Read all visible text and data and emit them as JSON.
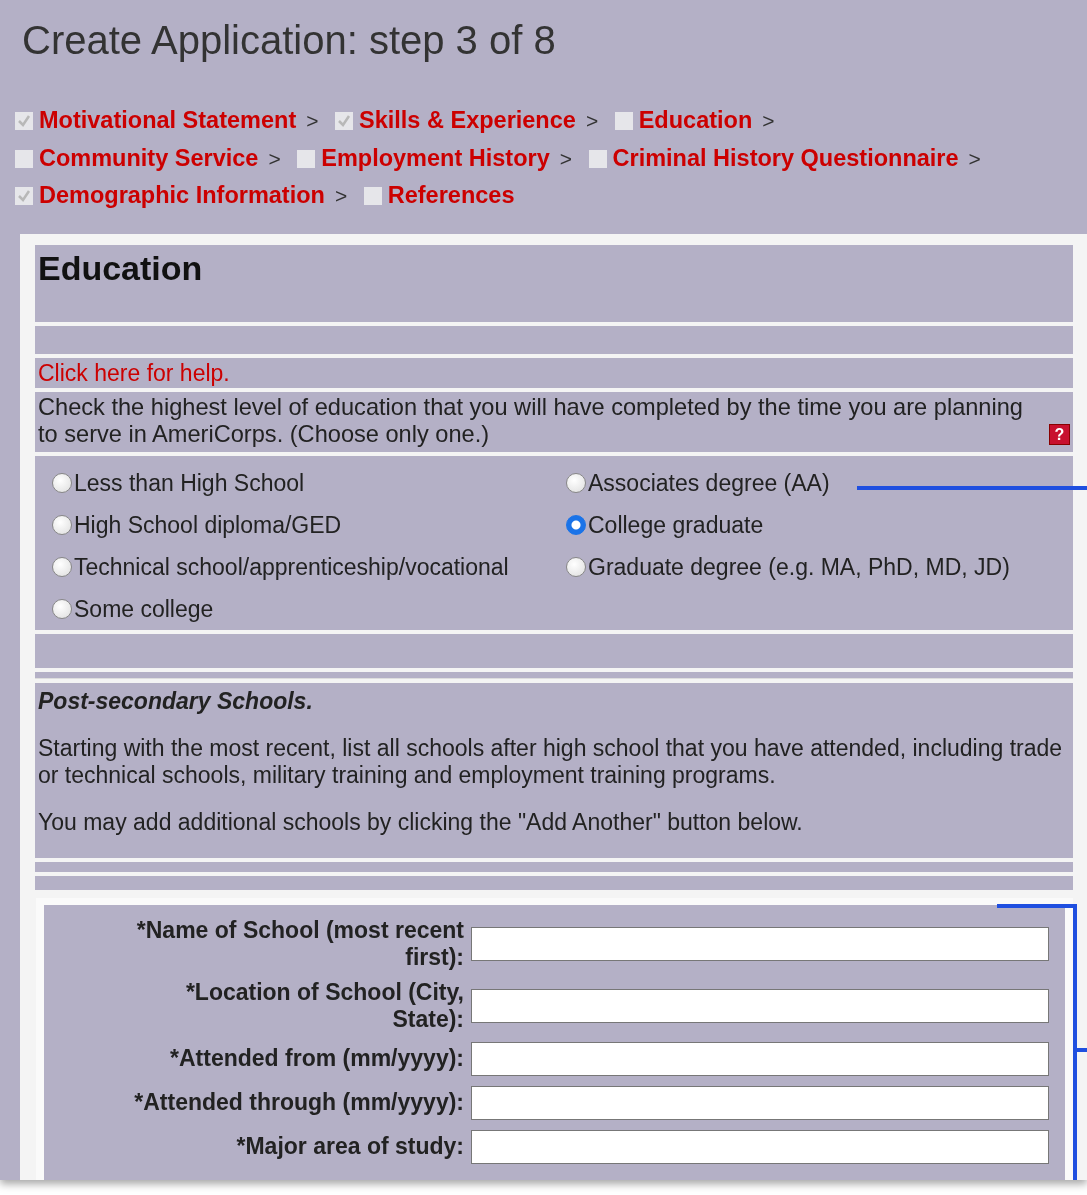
{
  "page": {
    "title": "Create Application: step 3 of 8"
  },
  "steps": [
    {
      "label": "Motivational Statement",
      "checked": true,
      "separator": ">"
    },
    {
      "label": "Skills & Experience",
      "checked": true,
      "separator": ">"
    },
    {
      "label": "Education",
      "checked": false,
      "separator": ">"
    },
    {
      "label": "Community Service",
      "checked": false,
      "separator": ">"
    },
    {
      "label": "Employment History",
      "checked": false,
      "separator": ">"
    },
    {
      "label": "Criminal History Questionnaire",
      "checked": false,
      "separator": ">"
    },
    {
      "label": "Demographic Information",
      "checked": true,
      "separator": ">"
    },
    {
      "label": "References",
      "checked": false
    }
  ],
  "education": {
    "title": "Education",
    "help_link": "Click here for help.",
    "question": "Check the highest level of education that you will have completed by the time you are planning to serve in AmeriCorps. (Choose only one.)",
    "help_icon": "?",
    "options": [
      {
        "label": "Less than High School",
        "selected": false
      },
      {
        "label": "Associates degree (AA)",
        "selected": false
      },
      {
        "label": "High School diploma/GED",
        "selected": false
      },
      {
        "label": "College graduate",
        "selected": true
      },
      {
        "label": "Technical school/apprenticeship/vocational",
        "selected": false
      },
      {
        "label": "Graduate degree (e.g. MA, PhD, MD, JD)",
        "selected": false
      },
      {
        "label": "Some college",
        "selected": false
      }
    ]
  },
  "post_secondary": {
    "title": "Post-secondary Schools.",
    "paragraphs": [
      "Starting with the most recent, list all schools after high school that you have attended, including trade or technical schools, military training and employment training programs.",
      "You may add additional schools by clicking the \"Add Another\" button below."
    ]
  },
  "school_form": {
    "fields": [
      {
        "label": "*Name of School (most recent first):"
      },
      {
        "label": "*Location of School (City, State):"
      },
      {
        "label": "*Attended from (mm/yyyy):"
      },
      {
        "label": "*Attended through (mm/yyyy):"
      },
      {
        "label": "*Major area of study:"
      }
    ]
  }
}
